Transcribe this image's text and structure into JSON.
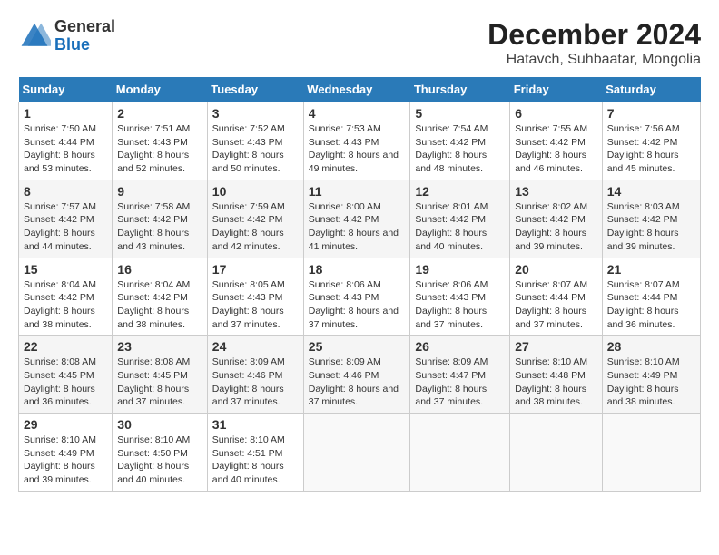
{
  "header": {
    "logo_line1": "General",
    "logo_line2": "Blue",
    "title": "December 2024",
    "subtitle": "Hatavch, Suhbaatar, Mongolia"
  },
  "days_of_week": [
    "Sunday",
    "Monday",
    "Tuesday",
    "Wednesday",
    "Thursday",
    "Friday",
    "Saturday"
  ],
  "weeks": [
    [
      {
        "day": "1",
        "sunrise": "7:50 AM",
        "sunset": "4:44 PM",
        "daylight": "8 hours and 53 minutes."
      },
      {
        "day": "2",
        "sunrise": "7:51 AM",
        "sunset": "4:43 PM",
        "daylight": "8 hours and 52 minutes."
      },
      {
        "day": "3",
        "sunrise": "7:52 AM",
        "sunset": "4:43 PM",
        "daylight": "8 hours and 50 minutes."
      },
      {
        "day": "4",
        "sunrise": "7:53 AM",
        "sunset": "4:43 PM",
        "daylight": "8 hours and 49 minutes."
      },
      {
        "day": "5",
        "sunrise": "7:54 AM",
        "sunset": "4:42 PM",
        "daylight": "8 hours and 48 minutes."
      },
      {
        "day": "6",
        "sunrise": "7:55 AM",
        "sunset": "4:42 PM",
        "daylight": "8 hours and 46 minutes."
      },
      {
        "day": "7",
        "sunrise": "7:56 AM",
        "sunset": "4:42 PM",
        "daylight": "8 hours and 45 minutes."
      }
    ],
    [
      {
        "day": "8",
        "sunrise": "7:57 AM",
        "sunset": "4:42 PM",
        "daylight": "8 hours and 44 minutes."
      },
      {
        "day": "9",
        "sunrise": "7:58 AM",
        "sunset": "4:42 PM",
        "daylight": "8 hours and 43 minutes."
      },
      {
        "day": "10",
        "sunrise": "7:59 AM",
        "sunset": "4:42 PM",
        "daylight": "8 hours and 42 minutes."
      },
      {
        "day": "11",
        "sunrise": "8:00 AM",
        "sunset": "4:42 PM",
        "daylight": "8 hours and 41 minutes."
      },
      {
        "day": "12",
        "sunrise": "8:01 AM",
        "sunset": "4:42 PM",
        "daylight": "8 hours and 40 minutes."
      },
      {
        "day": "13",
        "sunrise": "8:02 AM",
        "sunset": "4:42 PM",
        "daylight": "8 hours and 39 minutes."
      },
      {
        "day": "14",
        "sunrise": "8:03 AM",
        "sunset": "4:42 PM",
        "daylight": "8 hours and 39 minutes."
      }
    ],
    [
      {
        "day": "15",
        "sunrise": "8:04 AM",
        "sunset": "4:42 PM",
        "daylight": "8 hours and 38 minutes."
      },
      {
        "day": "16",
        "sunrise": "8:04 AM",
        "sunset": "4:42 PM",
        "daylight": "8 hours and 38 minutes."
      },
      {
        "day": "17",
        "sunrise": "8:05 AM",
        "sunset": "4:43 PM",
        "daylight": "8 hours and 37 minutes."
      },
      {
        "day": "18",
        "sunrise": "8:06 AM",
        "sunset": "4:43 PM",
        "daylight": "8 hours and 37 minutes."
      },
      {
        "day": "19",
        "sunrise": "8:06 AM",
        "sunset": "4:43 PM",
        "daylight": "8 hours and 37 minutes."
      },
      {
        "day": "20",
        "sunrise": "8:07 AM",
        "sunset": "4:44 PM",
        "daylight": "8 hours and 37 minutes."
      },
      {
        "day": "21",
        "sunrise": "8:07 AM",
        "sunset": "4:44 PM",
        "daylight": "8 hours and 36 minutes."
      }
    ],
    [
      {
        "day": "22",
        "sunrise": "8:08 AM",
        "sunset": "4:45 PM",
        "daylight": "8 hours and 36 minutes."
      },
      {
        "day": "23",
        "sunrise": "8:08 AM",
        "sunset": "4:45 PM",
        "daylight": "8 hours and 37 minutes."
      },
      {
        "day": "24",
        "sunrise": "8:09 AM",
        "sunset": "4:46 PM",
        "daylight": "8 hours and 37 minutes."
      },
      {
        "day": "25",
        "sunrise": "8:09 AM",
        "sunset": "4:46 PM",
        "daylight": "8 hours and 37 minutes."
      },
      {
        "day": "26",
        "sunrise": "8:09 AM",
        "sunset": "4:47 PM",
        "daylight": "8 hours and 37 minutes."
      },
      {
        "day": "27",
        "sunrise": "8:10 AM",
        "sunset": "4:48 PM",
        "daylight": "8 hours and 38 minutes."
      },
      {
        "day": "28",
        "sunrise": "8:10 AM",
        "sunset": "4:49 PM",
        "daylight": "8 hours and 38 minutes."
      }
    ],
    [
      {
        "day": "29",
        "sunrise": "8:10 AM",
        "sunset": "4:49 PM",
        "daylight": "8 hours and 39 minutes."
      },
      {
        "day": "30",
        "sunrise": "8:10 AM",
        "sunset": "4:50 PM",
        "daylight": "8 hours and 40 minutes."
      },
      {
        "day": "31",
        "sunrise": "8:10 AM",
        "sunset": "4:51 PM",
        "daylight": "8 hours and 40 minutes."
      },
      null,
      null,
      null,
      null
    ]
  ]
}
